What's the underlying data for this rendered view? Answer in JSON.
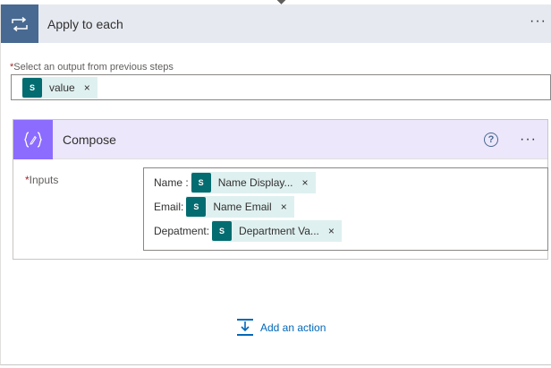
{
  "apply": {
    "title": "Apply to each",
    "more_icon": "ellipsis-icon",
    "select_label": "Select an output from previous steps",
    "required_mark": "*",
    "token": {
      "label": "value",
      "remove": "×",
      "icon": "sharepoint-icon"
    }
  },
  "compose": {
    "title": "Compose",
    "icon": "compose-braces-icon",
    "help": "?",
    "inputs_label": "Inputs",
    "required_mark": "*",
    "lines": [
      {
        "label": "Name :",
        "token": "Name Display...",
        "remove": "×"
      },
      {
        "label": "Email:",
        "token": "Name Email",
        "remove": "×"
      },
      {
        "label": "Depatment:",
        "token": "Department Va...",
        "remove": "×"
      }
    ]
  },
  "add_action": {
    "label": "Add an action",
    "icon": "add-action-icon"
  },
  "colors": {
    "apply_accent": "#486991",
    "compose_accent": "#8c6cff",
    "sharepoint": "#036c70",
    "link": "#0067b8"
  }
}
